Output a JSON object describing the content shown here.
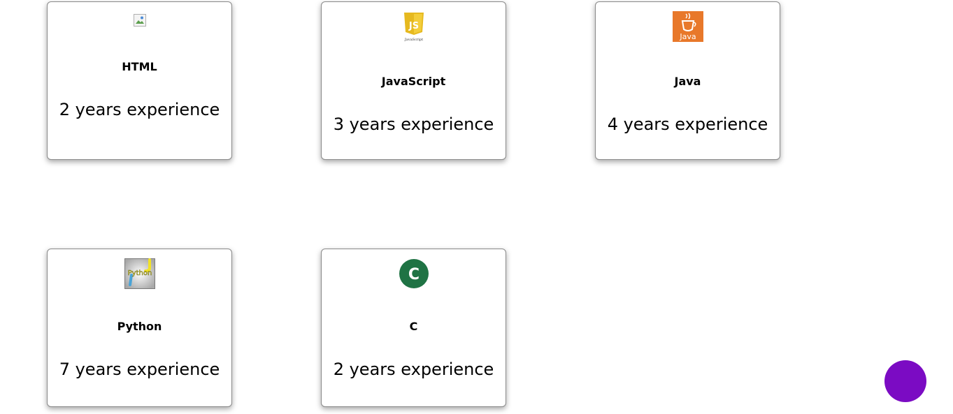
{
  "skills": [
    {
      "name": "HTML",
      "experience": "2 years experience",
      "icon": "html-broken-image-icon"
    },
    {
      "name": "JavaScript",
      "experience": "3 years experience",
      "icon": "javascript-logo-icon",
      "icon_text": "JavaScript"
    },
    {
      "name": "Java",
      "experience": "4 years experience",
      "icon": "java-logo-icon",
      "icon_text": "Java"
    },
    {
      "name": "Python",
      "experience": "7 years experience",
      "icon": "python-logo-icon",
      "icon_text": "Python"
    },
    {
      "name": "C",
      "experience": "2 years experience",
      "icon": "c-logo-icon",
      "icon_text": "C"
    }
  ],
  "colors": {
    "fab": "#7b0bc3",
    "js_yellow": "#e6b91f",
    "java_orange": "#e8782a",
    "c_green": "#1f7344"
  }
}
